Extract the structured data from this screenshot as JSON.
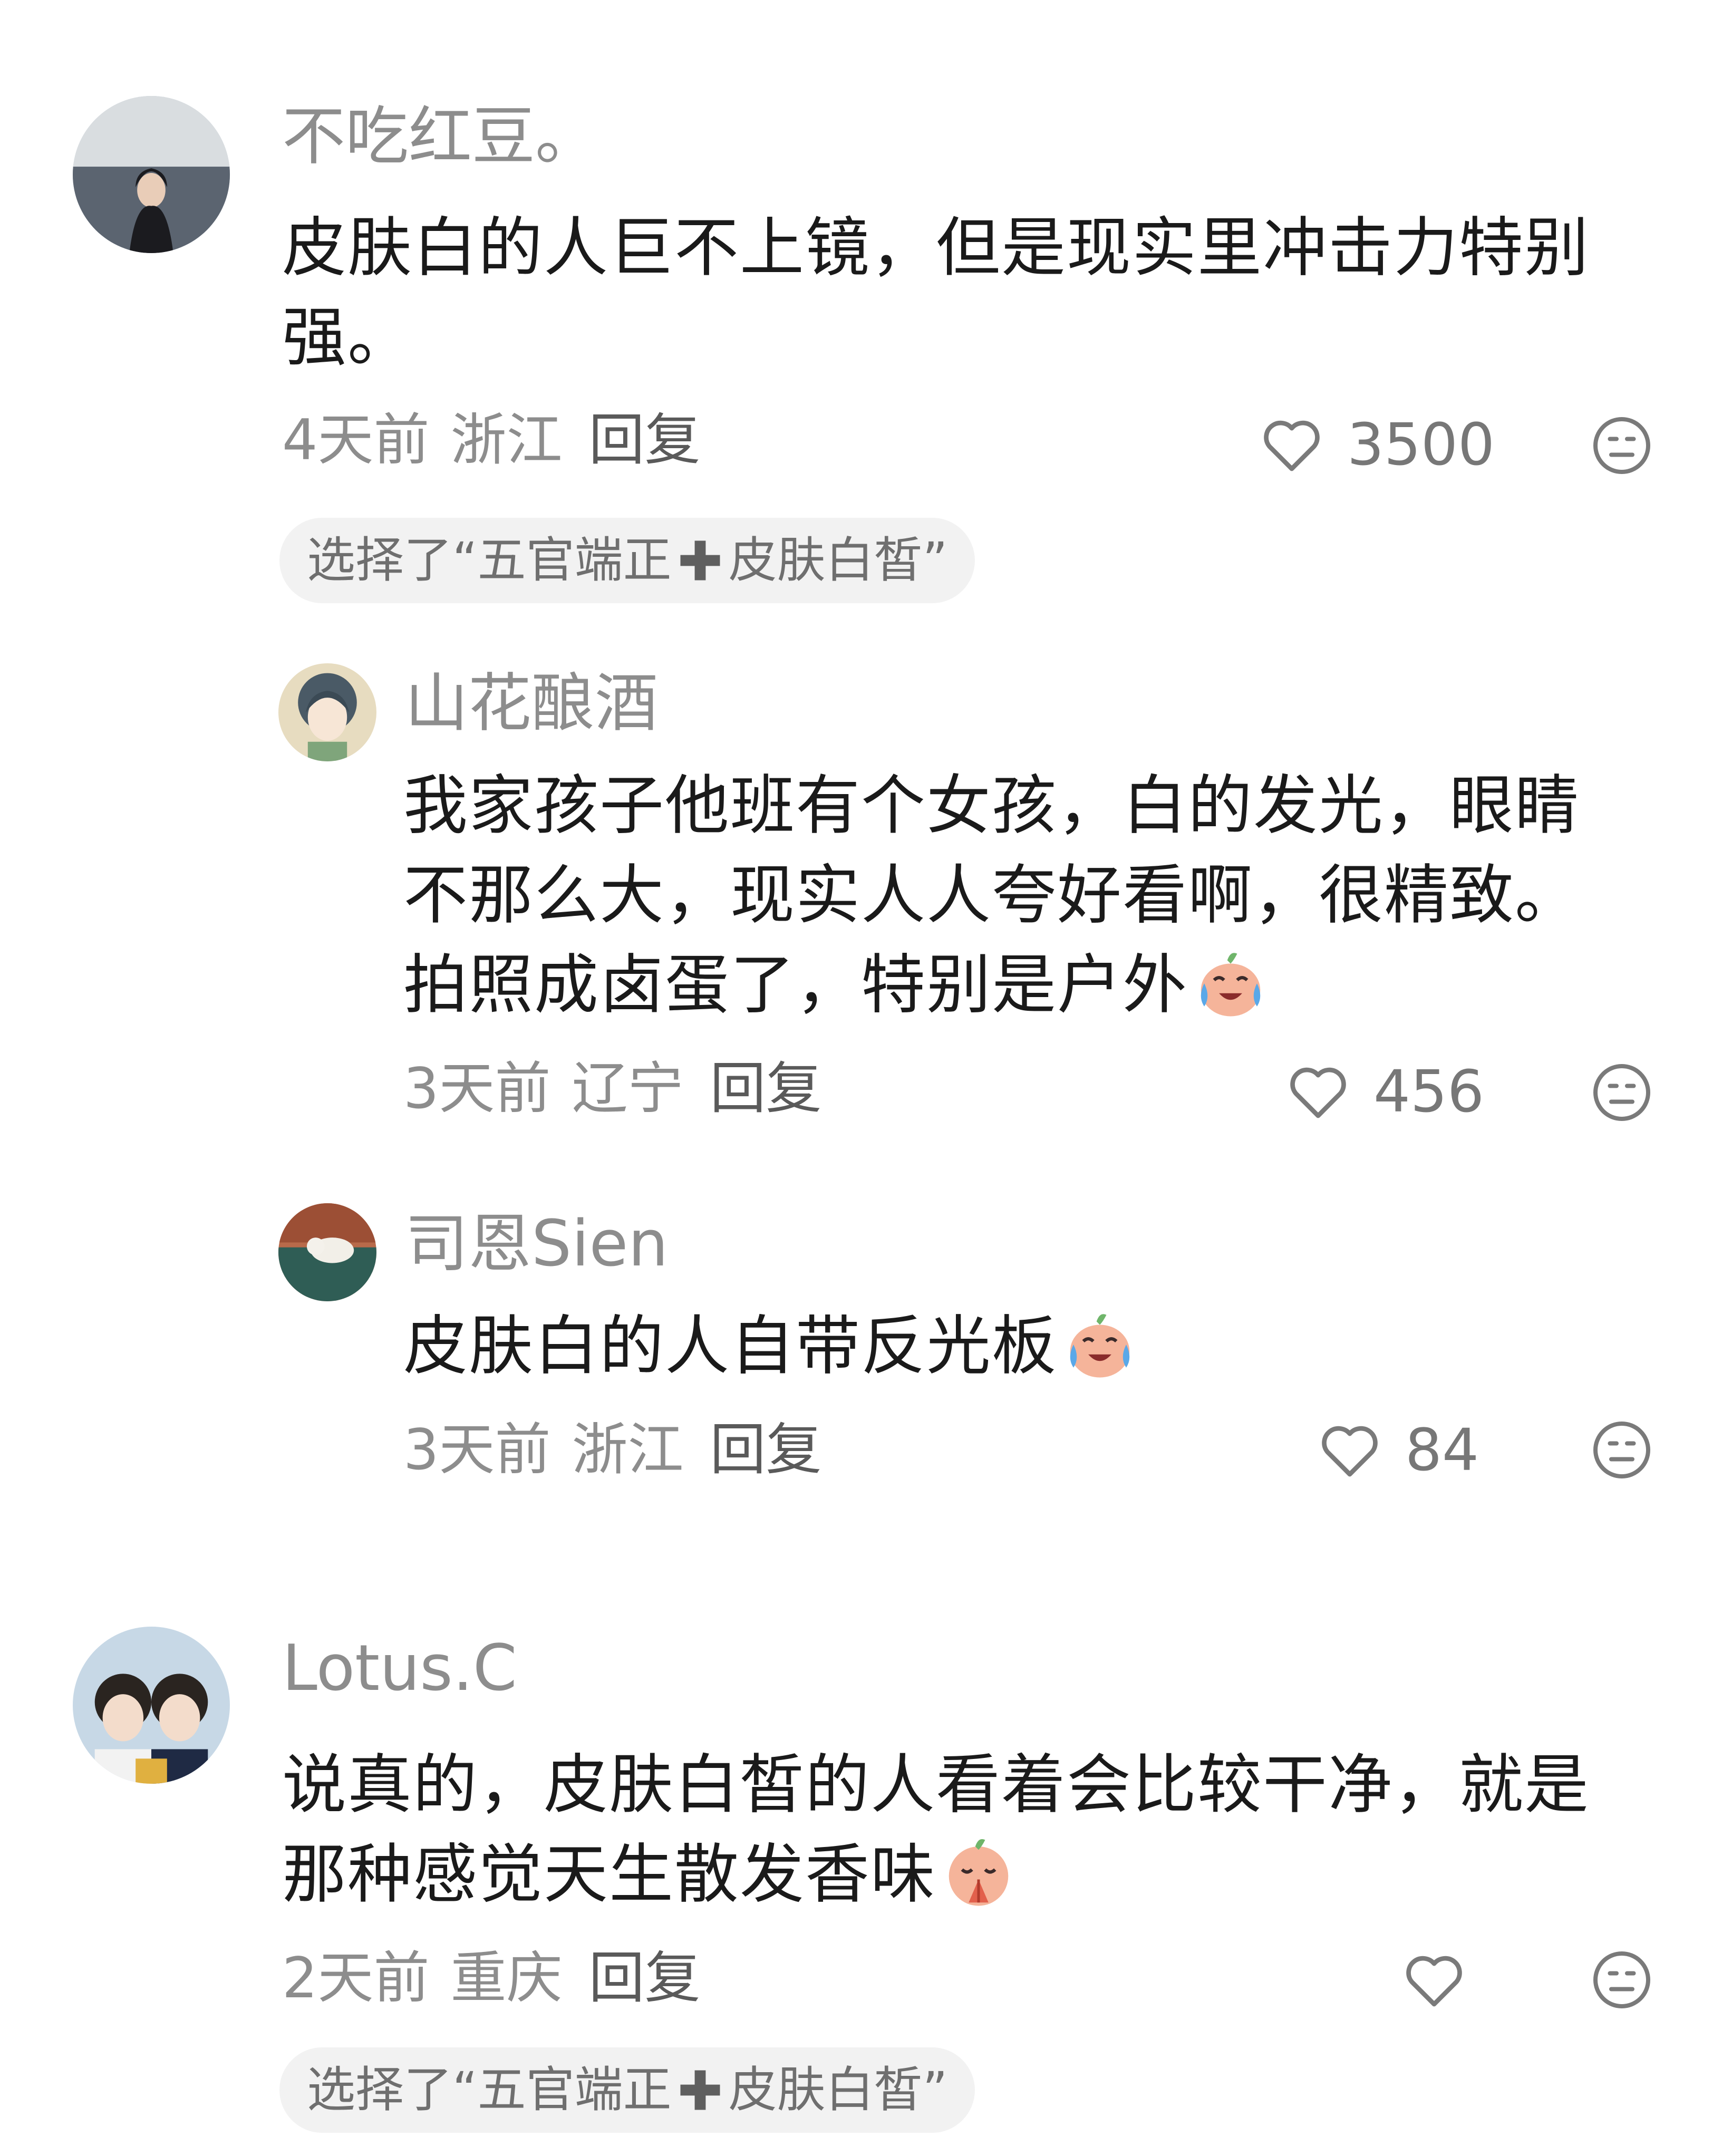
{
  "comments": [
    {
      "username": "不吃红豆。",
      "text_lines": [
        "皮肤白的人巨不上镜，但是现实里冲击力特别",
        "强。"
      ],
      "time": "4天前",
      "location": "浙江",
      "reply_label": "回复",
      "likes": "3500",
      "tag": {
        "prefix": "选择了“五官端正",
        "suffix": "皮肤白皙”"
      }
    },
    {
      "username": "山花酿酒",
      "text_lines": [
        "我家孩子他班有个女孩，白的发光，眼睛",
        "不那么大，现实人人夸好看啊，很精致。",
        "拍照成卤蛋了，特别是户外"
      ],
      "emoji": "crying-laughing-emoji",
      "time": "3天前",
      "location": "辽宁",
      "reply_label": "回复",
      "likes": "456"
    },
    {
      "username": "司恩Sien",
      "text_lines": [
        "皮肤白的人自带反光板"
      ],
      "emoji": "crying-laughing-emoji",
      "time": "3天前",
      "location": "浙江",
      "reply_label": "回复",
      "likes": "84"
    },
    {
      "username": "Lotus.C",
      "text_lines": [
        "说真的，皮肤白皙的人看着会比较干净，就是",
        "那种感觉天生散发香味"
      ],
      "emoji": "praying-emoji",
      "time": "2天前",
      "location": "重庆",
      "reply_label": "回复",
      "likes": "",
      "tag": {
        "prefix": "选择了“五官端正",
        "suffix": "皮肤白皙”"
      }
    }
  ],
  "colors": {
    "muted_text": "#8d8d8d",
    "body_text": "#1a1a1a",
    "tag_bg": "#f2f2f2",
    "plus_icon": "#5f5f5f"
  },
  "icons": {
    "like": "heart-outline-icon",
    "react": "neutral-face-icon",
    "tag_plus": "heavy-plus-icon"
  }
}
